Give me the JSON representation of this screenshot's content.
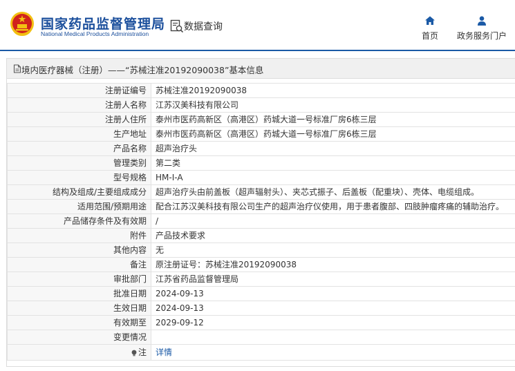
{
  "header": {
    "brand_cn": "国家药品监督管理局",
    "brand_en": "National Medical Products Administration",
    "query_label": "数据查询",
    "nav": [
      {
        "label": "首页",
        "icon": "home-icon"
      },
      {
        "label": "政务服务门户",
        "icon": "user-icon"
      }
    ]
  },
  "panel": {
    "title": "境内医疗器械（注册）——“苏械注准20192090038”基本信息"
  },
  "rows": [
    {
      "label": "注册证编号",
      "value": "苏械注准20192090038"
    },
    {
      "label": "注册人名称",
      "value": "江苏汉美科技有限公司"
    },
    {
      "label": "注册人住所",
      "value": "泰州市医药高新区（高港区）药城大道一号标准厂房6栋三层"
    },
    {
      "label": "生产地址",
      "value": "泰州市医药高新区（高港区）药城大道一号标准厂房6栋三层"
    },
    {
      "label": "产品名称",
      "value": "超声治疗头"
    },
    {
      "label": "管理类别",
      "value": "第二类"
    },
    {
      "label": "型号规格",
      "value": "HM-Ⅰ-A"
    },
    {
      "label": "结构及组成/主要组成成分",
      "value": "超声治疗头由前盖板（超声辐射头）、夹芯式振子、后盖板（配重块）、壳体、电缆组成。"
    },
    {
      "label": "适用范围/预期用途",
      "value": "配合江苏汉美科技有限公司生产的超声治疗仪使用，用于患者腹部、四肢肿瘤疼痛的辅助治疗。"
    },
    {
      "label": "产品储存条件及有效期",
      "value": "/"
    },
    {
      "label": "附件",
      "value": "产品技术要求"
    },
    {
      "label": "其他内容",
      "value": "无"
    },
    {
      "label": "备注",
      "value": "原注册证号：苏械注准20192090038"
    },
    {
      "label": "审批部门",
      "value": "江苏省药品监督管理局"
    },
    {
      "label": "批准日期",
      "value": "2024-09-13"
    },
    {
      "label": "生效日期",
      "value": "2024-09-13"
    },
    {
      "label": "有效期至",
      "value": "2029-09-12"
    },
    {
      "label": "变更情况",
      "value": ""
    }
  ],
  "note": {
    "label": "注",
    "link": "详情",
    "icon": "bulb-icon"
  },
  "colors": {
    "brand": "#1b4f9c",
    "accent": "#1b5aa6",
    "emblem_red": "#d0221c",
    "emblem_gold": "#f2c012"
  }
}
